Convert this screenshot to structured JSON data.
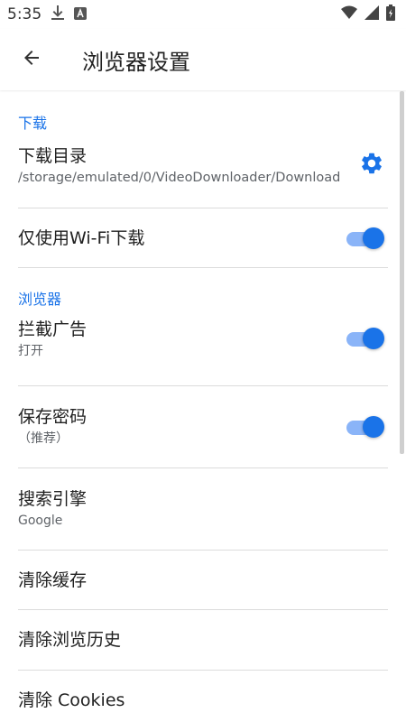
{
  "status_bar": {
    "time": "5:35",
    "icons": [
      "download-icon",
      "a-icon",
      "wifi-icon",
      "cell-signal-icon",
      "battery-icon"
    ]
  },
  "app_bar": {
    "back_icon": "arrow-left-icon",
    "title": "浏览器设置"
  },
  "sections": {
    "download": {
      "header": "下载",
      "directory_title": "下载目录",
      "directory_path": "/storage/emulated/0/VideoDownloader/Download",
      "wifi_only_title": "仅使用Wi-Fi下载",
      "wifi_only_on": true
    },
    "browser": {
      "header": "浏览器",
      "block_ads_title": "拦截广告",
      "block_ads_sub": "打开",
      "block_ads_on": true,
      "save_password_title": "保存密码",
      "save_password_sub": "（推荐）",
      "save_password_on": true,
      "search_engine_title": "搜索引擎",
      "search_engine_sub": "Google",
      "clear_cache": "清除缓存",
      "clear_history": "清除浏览历史",
      "clear_cookies": "清除 Cookies"
    }
  },
  "colors": {
    "accent": "#1a73e8",
    "toggle_track": "#8ab4f8",
    "divider": "#dcdcdc"
  }
}
